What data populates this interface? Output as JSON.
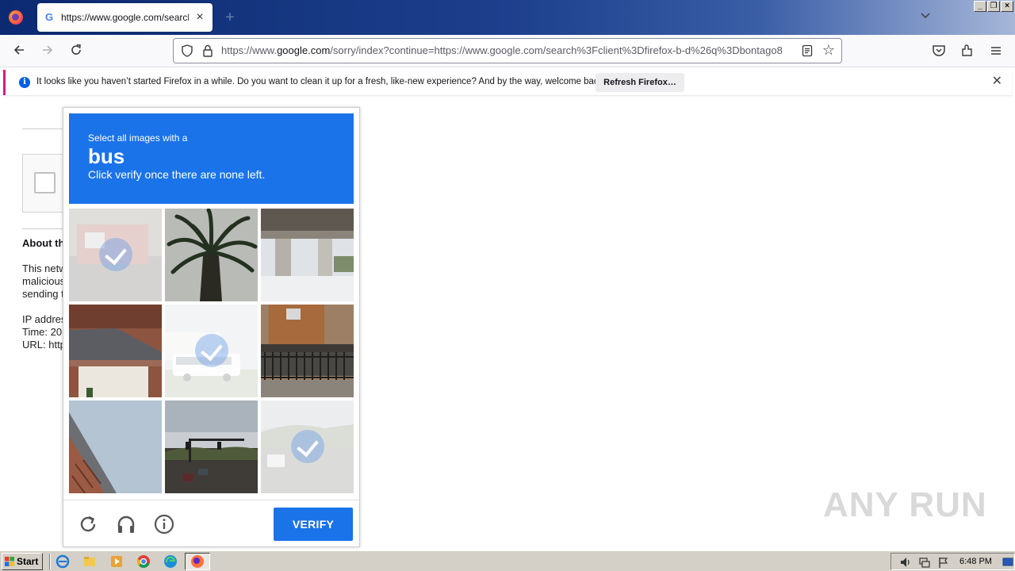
{
  "browser": {
    "tab": {
      "title": "https://www.google.com/search?c",
      "favicon": "google-g-icon"
    },
    "url": {
      "prefix": "https://www.",
      "host": "google.com",
      "rest": "/sorry/index?continue=https://www.google.com/search%3Fclient%3Dfirefox-b-d%26q%3Dbontago8"
    },
    "notification": {
      "message": "It looks like you haven’t started Firefox in a while. Do you want to clean it up for a fresh, like-new experience? And by the way, welcome back!",
      "button": "Refresh Firefox…",
      "icon": "info-icon"
    },
    "accent_color": "#1a73e8"
  },
  "page": {
    "about_title": "About th",
    "about_lines": [
      "This netw",
      "malicious",
      "sending t"
    ],
    "info_lines": [
      "IP addres",
      "Time: 20",
      "URL: http"
    ]
  },
  "captcha": {
    "instruction_line1": "Select all images with a",
    "target_word": "bus",
    "instruction_line2": "Click verify once there are none left.",
    "verify_label": "VERIFY",
    "tiles": [
      {
        "subject": "fire truck scene",
        "selected": true
      },
      {
        "subject": "palm tree",
        "selected": false
      },
      {
        "subject": "highway overpass pillars",
        "selected": false
      },
      {
        "subject": "brick house with garage",
        "selected": false
      },
      {
        "subject": "bus",
        "selected": true
      },
      {
        "subject": "house with porch and fence",
        "selected": false
      },
      {
        "subject": "brick house roof",
        "selected": false
      },
      {
        "subject": "road with traffic light",
        "selected": false
      },
      {
        "subject": "road scene",
        "selected": true
      }
    ],
    "icons": [
      "reload-icon",
      "headphones-icon",
      "info-icon"
    ]
  },
  "watermark": "ANY RUN",
  "taskbar": {
    "start_label": "Start",
    "time": "6:48 PM"
  }
}
